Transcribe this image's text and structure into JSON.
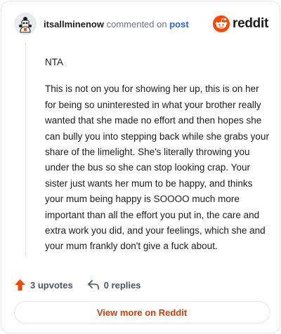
{
  "header": {
    "username": "itsallminenow",
    "action_text": "commented on",
    "post_link": "post",
    "brand": "reddit"
  },
  "comment": {
    "paragraphs": [
      "NTA",
      "This is not on you for showing her up, this is on her for being so uninterested in what your brother really wanted that she made no effort and then hopes she can bully you into stepping back while she grabs your share of the limelight. She's literally throwing you under the bus so she can stop looking crap. Your sister just wants her mum to be happy, and thinks your mum being happy is SOOOO much more important than all the effort you put in, the care and extra work you did, and your feelings, which she and your mum frankly don't give a fuck about."
    ]
  },
  "actions": {
    "upvotes": "3 upvotes",
    "replies": "0 replies"
  },
  "footer": {
    "view_more": "View more on Reddit"
  },
  "colors": {
    "accent": "#ff4500",
    "link": "#2563eb",
    "view_more": "#d93a00"
  }
}
